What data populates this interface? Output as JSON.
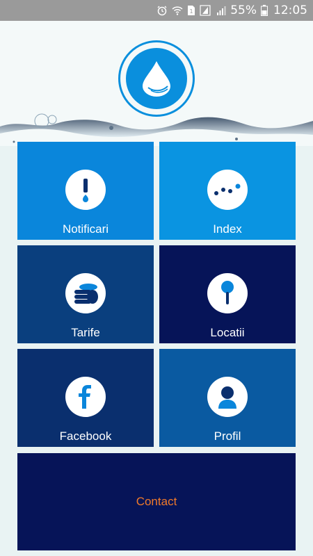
{
  "status_bar": {
    "battery": "55%",
    "time": "12:05",
    "icons": [
      "alarm-icon",
      "wifi-icon",
      "sim-icon",
      "signal-icon",
      "battery-icon"
    ]
  },
  "header": {
    "logo": "water-drop-logo"
  },
  "tiles": [
    {
      "label": "Notificari",
      "icon": "exclamation-icon",
      "color": "#0a86db"
    },
    {
      "label": "Index",
      "icon": "dots-graph-icon",
      "color": "#0a94e1"
    },
    {
      "label": "Tarife",
      "icon": "coins-icon",
      "color": "#0a3f7e"
    },
    {
      "label": "Locatii",
      "icon": "pin-icon",
      "color": "#061458"
    },
    {
      "label": "Facebook",
      "icon": "facebook-icon",
      "color": "#0a2f6e"
    },
    {
      "label": "Profil",
      "icon": "person-icon",
      "color": "#0a5aa1"
    }
  ],
  "contact": {
    "label": "Contact",
    "color": "#061458",
    "text_color": "#f07a2a"
  }
}
